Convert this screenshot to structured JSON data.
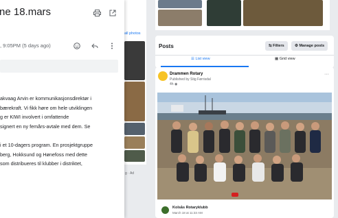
{
  "email": {
    "subject": "ne 18.mars",
    "time": ", 9:05PM (5 days ago)",
    "body_p1": [
      "akvaag Arvin er kommunikasjonsdirektør i",
      "bærekraft. Vi fikk høre om hele utviklingen",
      "g er KIWI involvert i omfattende",
      "signert en ny femårs-avtale med dem. Se"
    ],
    "body_p2": [
      "i et 10-dagers program. En prosjektgruppe",
      "berg, Hokksund og Hønefoss med dette",
      "som distribueres til klubber i distriktet,"
    ]
  },
  "facebook": {
    "all_photos": "all photos",
    "side_footer": "g · Ad",
    "posts": {
      "title": "Posts",
      "filters": "Filters",
      "manage": "Manage posts",
      "list_view": "List view",
      "grid_view": "Grid view"
    },
    "post": {
      "author": "Drammen Rotary",
      "published_by": "Published by Stig Førrisdal",
      "meta": "4h"
    },
    "next_post": {
      "author": "Kolsås Rotaryklubb",
      "meta": "March 18 at 11:33 AM"
    }
  },
  "colors": {
    "accent": "#1877f2",
    "fb_bg": "#e9ebee"
  }
}
